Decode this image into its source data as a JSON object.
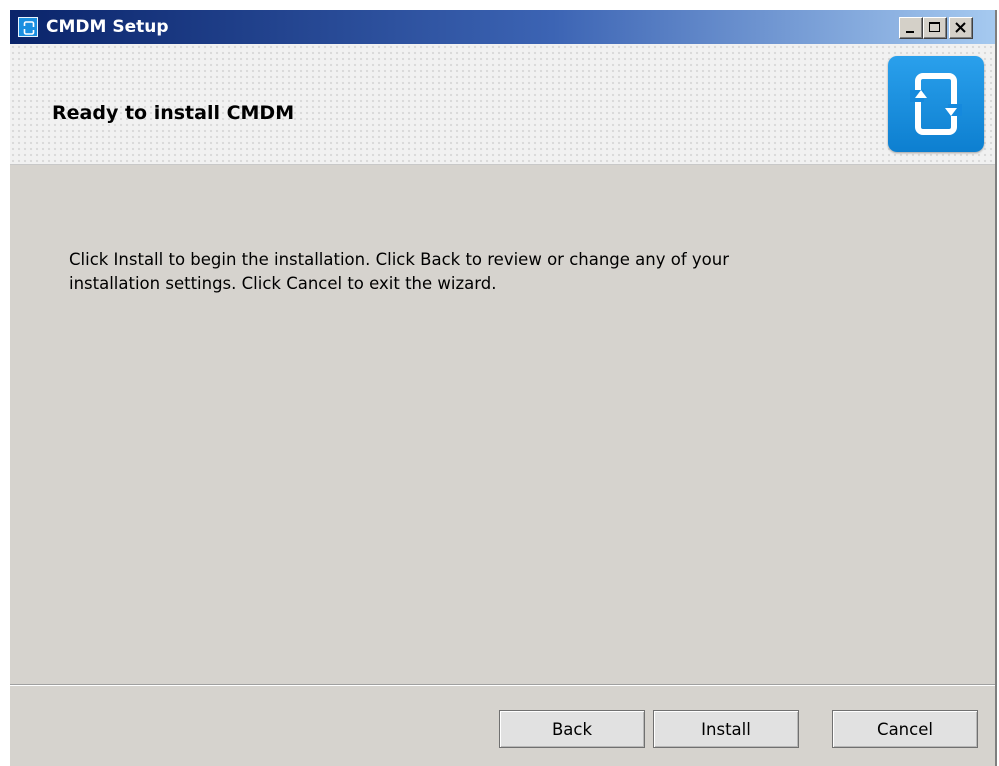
{
  "window": {
    "title": "CMDM Setup",
    "icon": "cmdm-app-icon",
    "caption_buttons": [
      "minimize-icon",
      "maximize-icon",
      "close-icon"
    ]
  },
  "banner": {
    "title": "Ready to install CMDM",
    "logo": "cmdm-logo-icon"
  },
  "body": {
    "line1": "Click Install to begin the installation. Click Back to review or change any of your",
    "line2": "installation settings. Click Cancel to exit the wizard."
  },
  "buttons": {
    "back": "Back",
    "install": "Install",
    "cancel": "Cancel"
  },
  "colors": {
    "titlebar_start": "#0a246a",
    "titlebar_end": "#a6caf0",
    "window_bg": "#d6d3ce",
    "logo_blue": "#1a8fe0"
  }
}
